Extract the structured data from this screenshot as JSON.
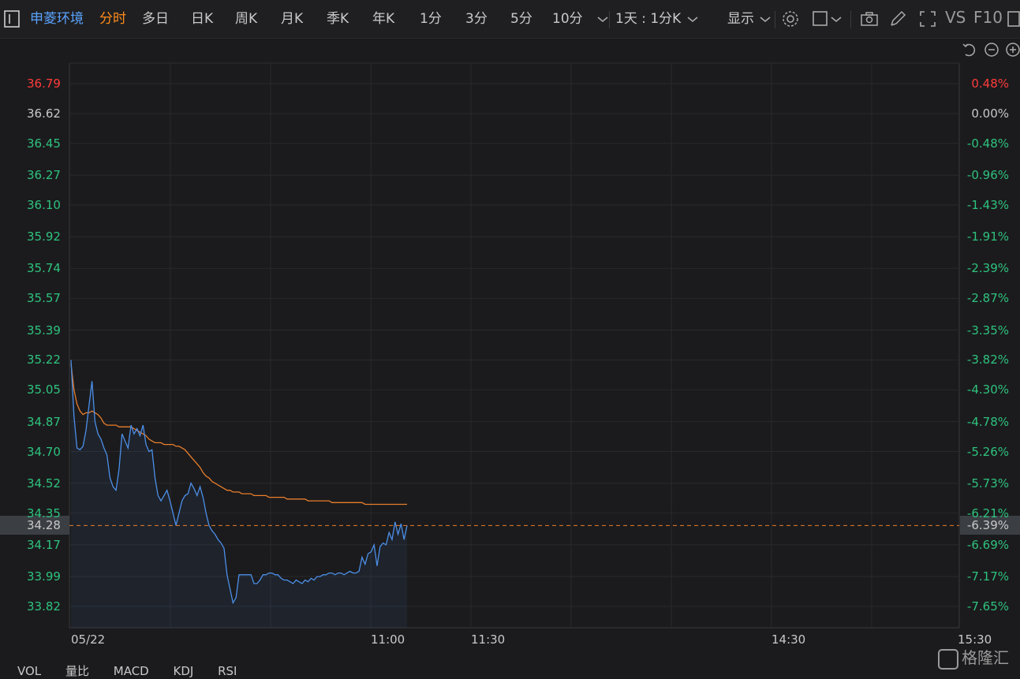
{
  "toolbar": {
    "stock_name": "申菱环境",
    "tabs": [
      "分时",
      "多日",
      "日K",
      "周K",
      "月K",
      "季K",
      "年K",
      "1分",
      "3分",
      "5分",
      "10分"
    ],
    "active_tab": "分时",
    "period_selector": "1天 : 1分K",
    "display_label": "显示",
    "vs_label": "VS",
    "f10_label": "F10"
  },
  "chart_data": {
    "type": "line",
    "date": "05/22",
    "prev_close": 36.62,
    "current_price": 34.28,
    "current_pct": "-6.39%",
    "y_left_ticks": [
      "36.79",
      "36.62",
      "36.45",
      "36.27",
      "36.10",
      "35.92",
      "35.74",
      "35.57",
      "35.39",
      "35.22",
      "35.05",
      "34.87",
      "34.70",
      "34.52",
      "34.35",
      "34.17",
      "33.99",
      "33.82"
    ],
    "y_right_ticks": [
      "0.48%",
      "0.00%",
      "-0.48%",
      "-0.96%",
      "-1.43%",
      "-1.91%",
      "-2.39%",
      "-2.87%",
      "-3.35%",
      "-3.82%",
      "-4.30%",
      "-4.78%",
      "-5.26%",
      "-5.73%",
      "-6.21%",
      "-6.69%",
      "-7.17%",
      "-7.65%"
    ],
    "ylim": [
      33.82,
      36.79
    ],
    "x_ticks": [
      "05/22",
      "11:00",
      "11:30",
      "14:30",
      "15:30"
    ],
    "series": [
      {
        "name": "price",
        "color": "#4c8fe8",
        "values": [
          35.22,
          34.9,
          34.72,
          34.71,
          34.73,
          34.82,
          34.96,
          35.1,
          34.87,
          34.8,
          34.77,
          34.72,
          34.68,
          34.55,
          34.5,
          34.48,
          34.6,
          34.8,
          34.76,
          34.72,
          34.85,
          34.8,
          34.83,
          34.79,
          34.85,
          34.74,
          34.7,
          34.71,
          34.55,
          34.45,
          34.42,
          34.45,
          34.48,
          34.42,
          34.35,
          34.28,
          34.35,
          34.42,
          34.45,
          34.46,
          34.52,
          34.49,
          34.45,
          34.5,
          34.44,
          34.35,
          34.28,
          34.25,
          34.23,
          34.2,
          34.18,
          34.15,
          34.0,
          33.92,
          33.84,
          33.87,
          34.0,
          34.0,
          34.0,
          34.0,
          34.0,
          33.95,
          33.95,
          33.97,
          34.0,
          34.0,
          34.01,
          34.01,
          34.0,
          34.0,
          33.98,
          33.97,
          33.97,
          33.96,
          33.95,
          33.97,
          33.96,
          33.95,
          33.97,
          33.96,
          33.98,
          33.97,
          33.99,
          33.99,
          34.0,
          34.0,
          34.01,
          34.01,
          34.0,
          34.01,
          34.01,
          34.0,
          34.01,
          34.02,
          34.01,
          34.01,
          34.02,
          34.1,
          34.06,
          34.12,
          34.13,
          34.17,
          34.05,
          34.16,
          34.18,
          34.17,
          34.24,
          34.2,
          34.3,
          34.23,
          34.29,
          34.2,
          34.28
        ]
      },
      {
        "name": "avg",
        "color": "#e87e2c",
        "values": [
          35.2,
          35.05,
          34.97,
          34.93,
          34.91,
          34.92,
          34.92,
          34.93,
          34.92,
          34.91,
          34.89,
          34.86,
          34.85,
          34.85,
          34.85,
          34.85,
          34.84,
          34.84,
          34.84,
          34.84,
          34.84,
          34.83,
          34.82,
          34.81,
          34.8,
          34.79,
          34.77,
          34.76,
          34.75,
          34.75,
          34.75,
          34.74,
          34.74,
          34.74,
          34.74,
          34.73,
          34.73,
          34.72,
          34.71,
          34.69,
          34.67,
          34.65,
          34.63,
          34.61,
          34.58,
          34.56,
          34.55,
          34.53,
          34.52,
          34.51,
          34.5,
          34.49,
          34.48,
          34.48,
          34.47,
          34.47,
          34.47,
          34.46,
          34.46,
          34.46,
          34.46,
          34.45,
          34.45,
          34.45,
          34.45,
          34.45,
          34.44,
          34.44,
          34.44,
          34.44,
          34.44,
          34.44,
          34.43,
          34.43,
          34.43,
          34.43,
          34.43,
          34.43,
          34.43,
          34.42,
          34.42,
          34.42,
          34.42,
          34.42,
          34.42,
          34.42,
          34.42,
          34.41,
          34.41,
          34.41,
          34.41,
          34.41,
          34.41,
          34.41,
          34.41,
          34.41,
          34.41,
          34.41,
          34.4,
          34.4,
          34.4,
          34.4,
          34.4,
          34.4,
          34.4,
          34.4,
          34.4,
          34.4,
          34.4,
          34.4,
          34.4,
          34.4,
          34.4
        ]
      }
    ]
  },
  "bottom_tabs": [
    "VOL",
    "量比",
    "MACD",
    "KDJ",
    "RSI"
  ],
  "watermark": "格隆汇"
}
